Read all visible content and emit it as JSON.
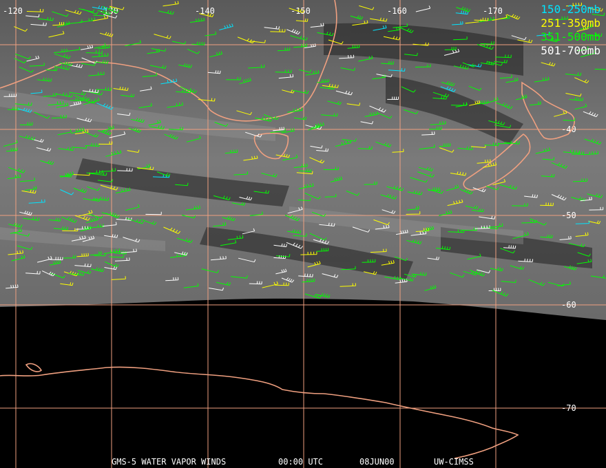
{
  "map": {
    "longitude_labels": [
      "-120",
      "-130",
      "-140",
      "-150",
      "-160",
      "-170"
    ],
    "latitude_labels": [
      "-40",
      "-50",
      "-60",
      "-70"
    ],
    "colors": {
      "background": "#000000",
      "cloud_field": "#6a6a6a",
      "grid": "#f0a080",
      "coastline": "#f0a080"
    }
  },
  "legend": [
    {
      "label": "150-250mb",
      "color": "#00e5ff"
    },
    {
      "label": "251-350mb",
      "color": "#ffff00"
    },
    {
      "label": "351-500mb",
      "color": "#00ff00"
    },
    {
      "label": "501-700mb",
      "color": "#ffffff"
    }
  ],
  "footer": {
    "product": "GMS-5 WATER VAPOR WINDS",
    "time": "00:00 UTC",
    "date": "08JUN00",
    "source": "UW-CIMSS"
  }
}
